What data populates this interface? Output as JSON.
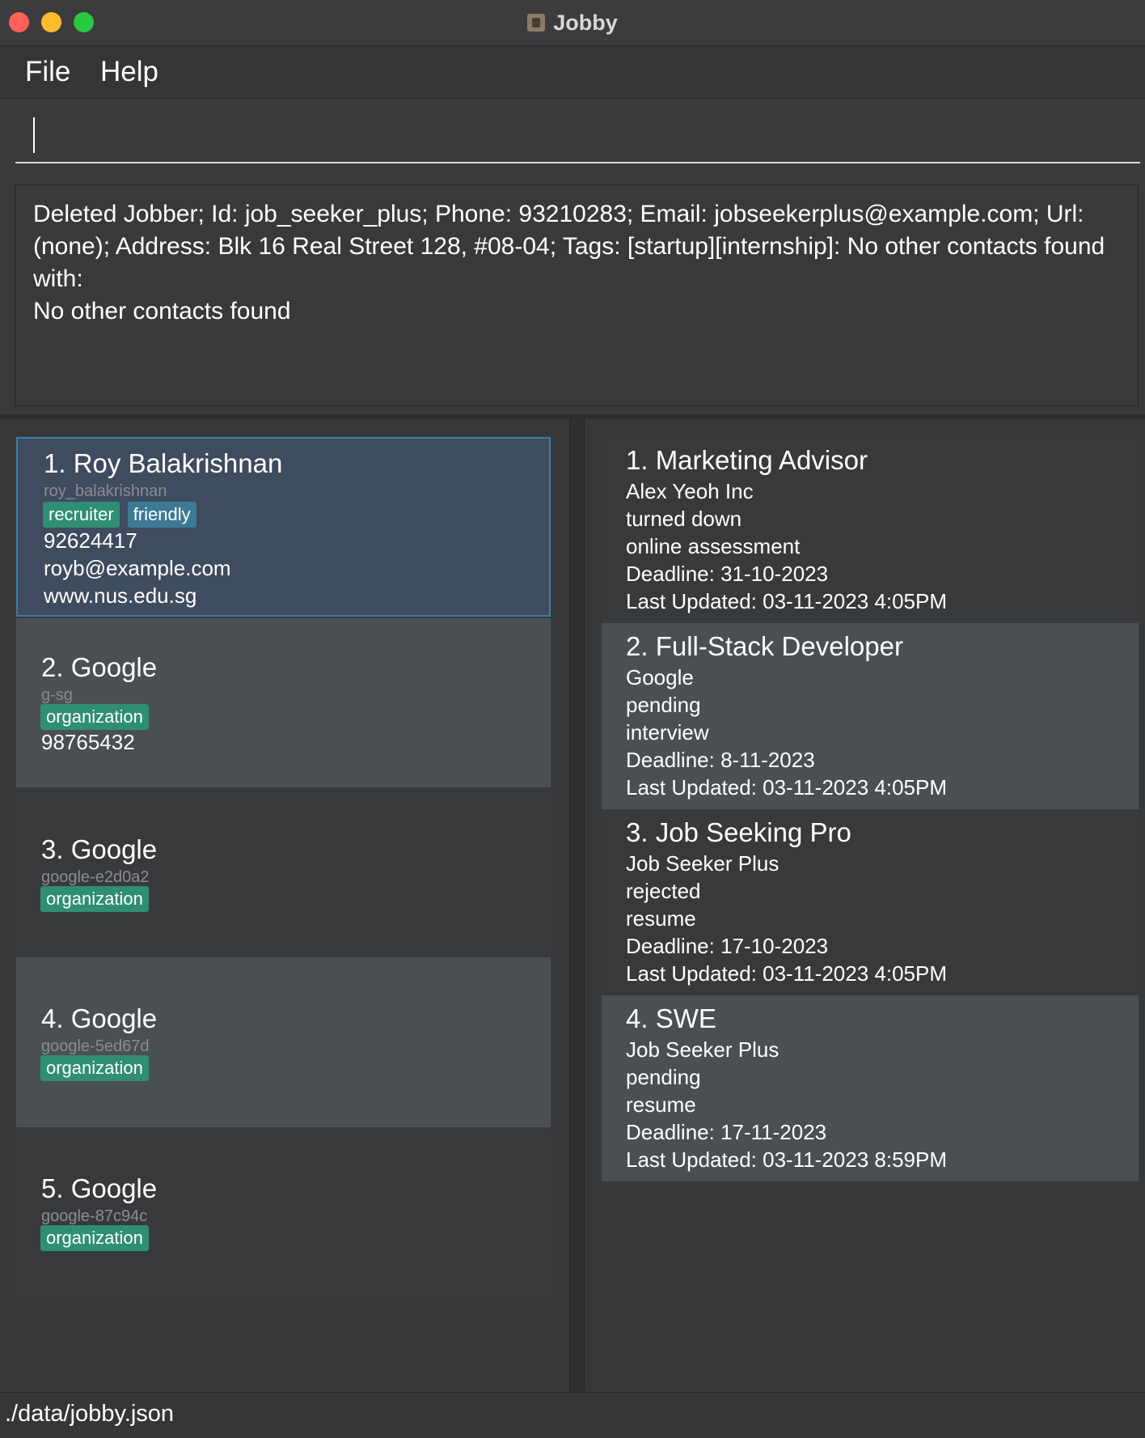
{
  "window": {
    "title": "Jobby"
  },
  "menu": {
    "file": "File",
    "help": "Help"
  },
  "command": {
    "value": ""
  },
  "result": {
    "text": "Deleted Jobber; Id: job_seeker_plus; Phone: 93210283; Email: jobseekerplus@example.com; Url: (none); Address: Blk 16 Real Street 128, #08-04; Tags: [startup][internship]: No other contacts found with:\nNo other contacts found"
  },
  "contacts": [
    {
      "title": "1.  Roy Balakrishnan",
      "id": "roy_balakrishnan",
      "tags": [
        "recruiter",
        "friendly"
      ],
      "phone": "92624417",
      "email": "royb@example.com",
      "url": "www.nus.edu.sg"
    },
    {
      "title": "2.  Google",
      "id": "g-sg",
      "tags": [
        "organization"
      ],
      "phone": "98765432"
    },
    {
      "title": "3.  Google",
      "id": "google-e2d0a2",
      "tags": [
        "organization"
      ]
    },
    {
      "title": "4.  Google",
      "id": "google-5ed67d",
      "tags": [
        "organization"
      ]
    },
    {
      "title": "5.  Google",
      "id": "google-87c94c",
      "tags": [
        "organization"
      ]
    }
  ],
  "jobs": [
    {
      "title": "1.  Marketing Advisor",
      "company": "Alex Yeoh Inc",
      "status": "turned down",
      "stage": "online assessment",
      "deadline": "Deadline: 31-10-2023",
      "updated": "Last Updated: 03-11-2023 4:05PM"
    },
    {
      "title": "2.  Full-Stack Developer",
      "company": "Google",
      "status": "pending",
      "stage": "interview",
      "deadline": "Deadline: 8-11-2023",
      "updated": "Last Updated: 03-11-2023 4:05PM"
    },
    {
      "title": "3.  Job Seeking Pro",
      "company": "Job Seeker Plus",
      "status": "rejected",
      "stage": "resume",
      "deadline": "Deadline: 17-10-2023",
      "updated": "Last Updated: 03-11-2023 4:05PM"
    },
    {
      "title": "4.  SWE",
      "company": "Job Seeker Plus",
      "status": "pending",
      "stage": "resume",
      "deadline": "Deadline: 17-11-2023",
      "updated": "Last Updated: 03-11-2023 8:59PM"
    }
  ],
  "status": {
    "path": "./data/jobby.json"
  }
}
